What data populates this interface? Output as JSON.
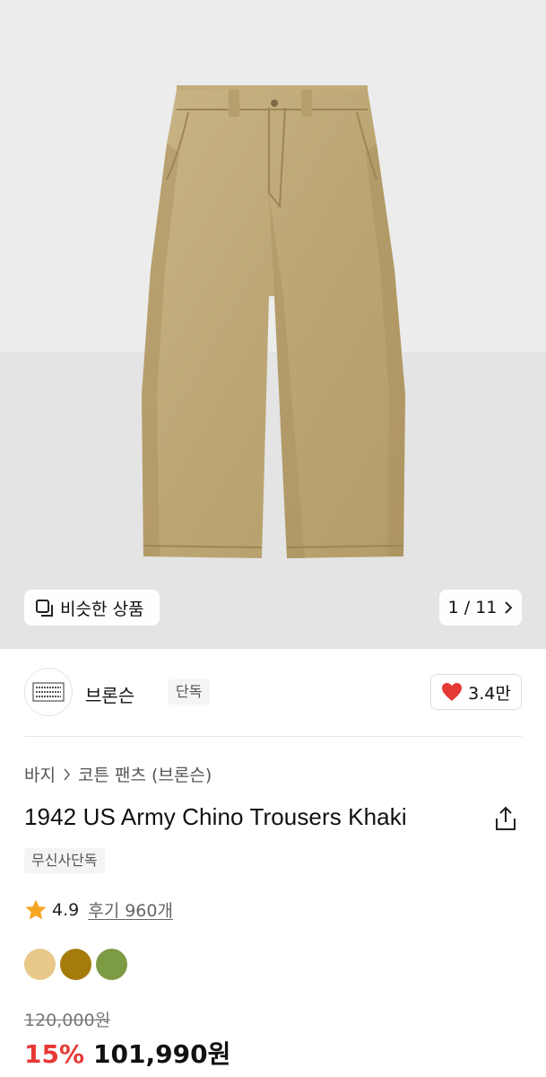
{
  "hero": {
    "similar_label": "비슷한 상품",
    "pager": "1 / 11"
  },
  "brand": {
    "name": "브론슨",
    "exclusive_tag": "단독",
    "likes": "3.4만"
  },
  "product": {
    "breadcrumb": [
      "바지",
      "코튼 팬츠 (브론슨)"
    ],
    "title": "1942 US Army Chino Trousers Khaki",
    "badge": "무신사단독",
    "rating": "4.9",
    "reviews": "후기 960개",
    "colors": [
      "#e8c98a",
      "#a57c0c",
      "#7d9a44"
    ],
    "original_price": "120,000원",
    "discount": "15%",
    "price": "101,990원"
  },
  "icons": {
    "similar": "similar-items-icon",
    "pager_next": "chevron-right-icon",
    "like": "heart-icon",
    "breadcrumb_sep": "chevron-right-icon",
    "share": "share-icon",
    "star": "star-icon"
  },
  "accent": {
    "discount_red": "#e53935",
    "heart_red": "#e53935",
    "star_orange": "#f5a623"
  }
}
